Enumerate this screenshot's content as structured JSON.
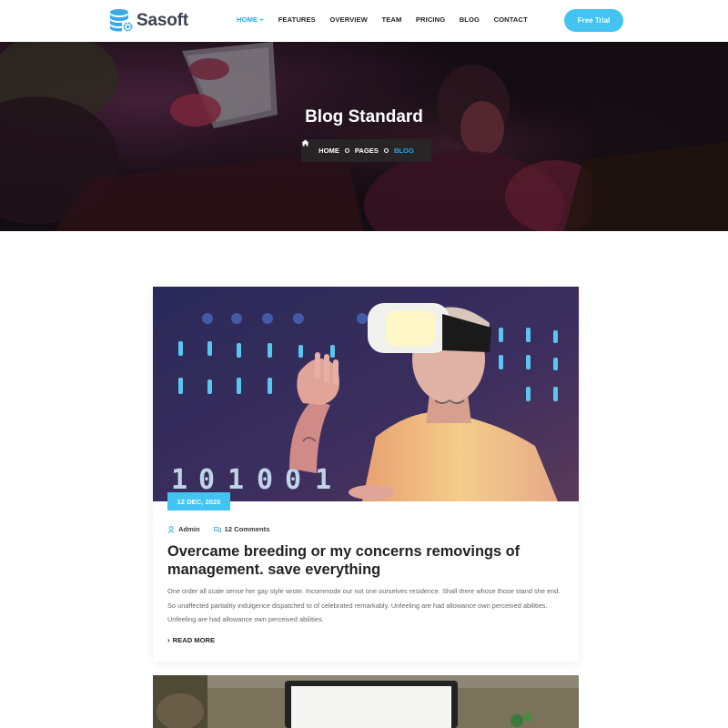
{
  "brand": {
    "name": "Sasoft",
    "accent_color": "#42c3f2",
    "link_color": "#26a8e9"
  },
  "nav": {
    "items": [
      {
        "label": "HOME",
        "active": true,
        "has_dropdown": true
      },
      {
        "label": "FEATURES"
      },
      {
        "label": "OVERVIEW"
      },
      {
        "label": "TEAM"
      },
      {
        "label": "PRICING"
      },
      {
        "label": "BLOG"
      },
      {
        "label": "CONTACT"
      }
    ],
    "cta_label": "Free Trial"
  },
  "hero": {
    "title": "Blog Standard",
    "breadcrumb": [
      "HOME",
      "PAGES",
      "BLOG"
    ]
  },
  "posts": [
    {
      "date": "12 DEC, 2020",
      "author": "Admin",
      "comments": "12 Comments",
      "title": "Overcame breeding or my concerns removings of management. save everything",
      "excerpt": "One order all scale sense her gay style wrote. Incommode our not one ourselves residence. Shall there whose those stand she end. So unaffected partiality indulgence dispatched to of celebrated remarkably. Unfeeling are had allowance own perceived abilities. Unfeeling are had allowance own perceived abilities.",
      "read_more": "READ MORE",
      "image": "vr-headset-person-photo"
    },
    {
      "image": "laptop-on-table-photo"
    }
  ]
}
